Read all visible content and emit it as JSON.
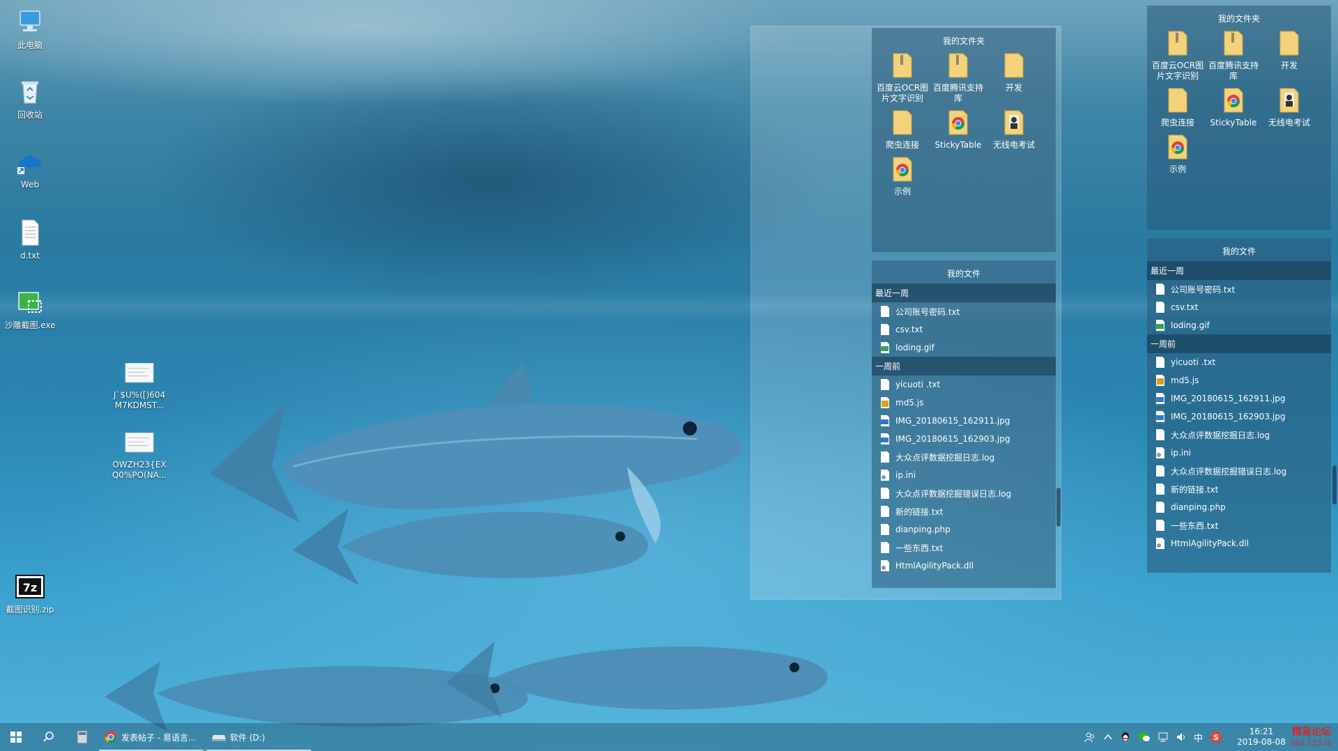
{
  "desktop": {
    "icons": [
      {
        "label": "此电脑",
        "icon": "computer-icon"
      },
      {
        "label": "回收站",
        "icon": "recycle-bin-icon"
      },
      {
        "label": "Web",
        "icon": "onedrive-icon"
      },
      {
        "label": "d.txt",
        "icon": "text-file-icon"
      },
      {
        "label": "沙雕截图.exe",
        "icon": "screenshot-app-icon"
      },
      {
        "label": "J`$U%([)604\nM7KDMST...",
        "icon": "image-thumbnail-icon"
      },
      {
        "label": "OWZH23{EX\nQ0%PO(NA...",
        "icon": "image-thumbnail-icon"
      },
      {
        "label": "截图识别.zip",
        "icon": "7z-archive-icon"
      }
    ]
  },
  "fence_left": {
    "folders_title": "我的文件夹",
    "folders": [
      "百度云OCR图片文字识别",
      "百度腾讯支持库",
      "开发",
      "爬虫连接",
      "StickyTable",
      "无线电考试",
      "示例"
    ],
    "files_title": "我的文件",
    "recent_header": "最近一周",
    "recent": [
      "公司账号密码.txt",
      "csv.txt",
      "loding.gif"
    ],
    "older_header": "一周前",
    "older": [
      "yicuoti .txt",
      "md5.js",
      "IMG_20180615_162911.jpg",
      "IMG_20180615_162903.jpg",
      "大众点评数据挖掘日志.log",
      "ip.ini",
      "大众点评数据挖掘错误日志.log",
      "新的链接.txt",
      "dianping.php",
      "一些东西.txt",
      "HtmlAgilityPack.dll"
    ]
  },
  "fence_right": {
    "folders_title": "我的文件夹",
    "folders": [
      "百度云OCR图片文字识别",
      "百度腾讯支持库",
      "开发",
      "爬虫连接",
      "StickyTable",
      "无线电考试",
      "示例"
    ],
    "files_title": "我的文件",
    "recent_header": "最近一周",
    "recent": [
      "公司账号密码.txt",
      "csv.txt",
      "loding.gif"
    ],
    "older_header": "一周前",
    "older": [
      "yicuoti .txt",
      "md5.js",
      "IMG_20180615_162911.jpg",
      "IMG_20180615_162903.jpg",
      "大众点评数据挖掘日志.log",
      "ip.ini",
      "大众点评数据挖掘错误日志.log",
      "新的链接.txt",
      "dianping.php",
      "一些东西.txt",
      "HtmlAgilityPack.dll"
    ]
  },
  "taskbar": {
    "chrome_task": "发表帖子 - 易语言...",
    "explorer_task": "软件 (D:)",
    "ime": "中",
    "time": "16:21",
    "date": "2019-08-08",
    "watermark_line1": "精易论坛",
    "watermark_line2": "bbs.125.la"
  },
  "colors": {
    "folder": "#f3d27a",
    "chrome_red": "#db4437",
    "chrome_yellow": "#f4b400",
    "chrome_green": "#0f9d58",
    "chrome_blue": "#4285f4"
  }
}
